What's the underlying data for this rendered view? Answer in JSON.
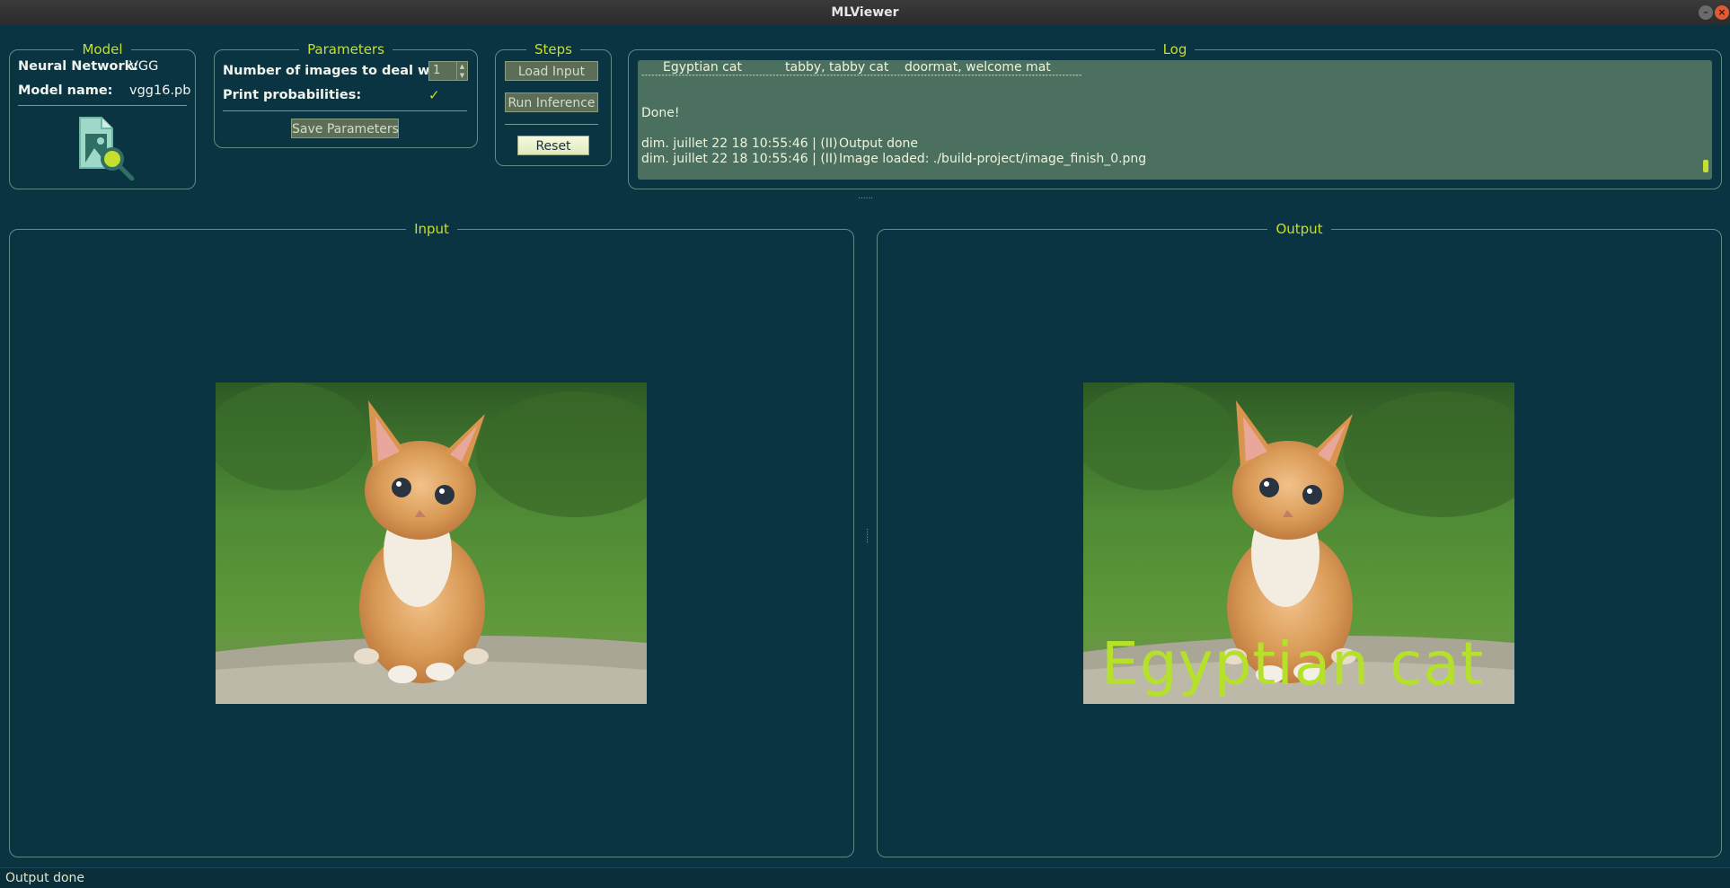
{
  "window": {
    "title": "MLViewer"
  },
  "model": {
    "title": "Model",
    "network_label": "Neural Network:",
    "network_value": "VGG",
    "name_label": "Model name:",
    "name_value": "vgg16.pb",
    "icon": "image-search-icon"
  },
  "parameters": {
    "title": "Parameters",
    "num_images_label": "Number of images to deal with:",
    "num_images_value": "1",
    "print_prob_label": "Print probabilities:",
    "print_prob_checked": "✓",
    "save_button": "Save Parameters"
  },
  "steps": {
    "title": "Steps",
    "load_button": "Load Input",
    "run_button": "Run Inference",
    "reset_button": "Reset"
  },
  "log": {
    "title": "Log",
    "top_predictions": [
      "Egyptian cat",
      "tabby, tabby cat",
      "doormat, welcome mat"
    ],
    "separator": "-----------------------------------------------------------------------------------------------------------------------------------",
    "done": "Done!",
    "entries": [
      {
        "timestamp": "dim. juillet 22 18 10:55:46 | (II)",
        "message": "Output done"
      },
      {
        "timestamp": "dim. juillet 22 18 10:55:46 | (II)",
        "message": "Image loaded: ./build-project/image_finish_0.png"
      }
    ]
  },
  "input_panel": {
    "title": "Input"
  },
  "output_panel": {
    "title": "Output",
    "overlay_label": "Egyptian cat"
  },
  "status_bar": {
    "text": "Output done"
  },
  "colors": {
    "background": "#0b3443",
    "accent": "#c6df2e",
    "border": "#5d8c86",
    "log_bg": "#4c705f"
  }
}
